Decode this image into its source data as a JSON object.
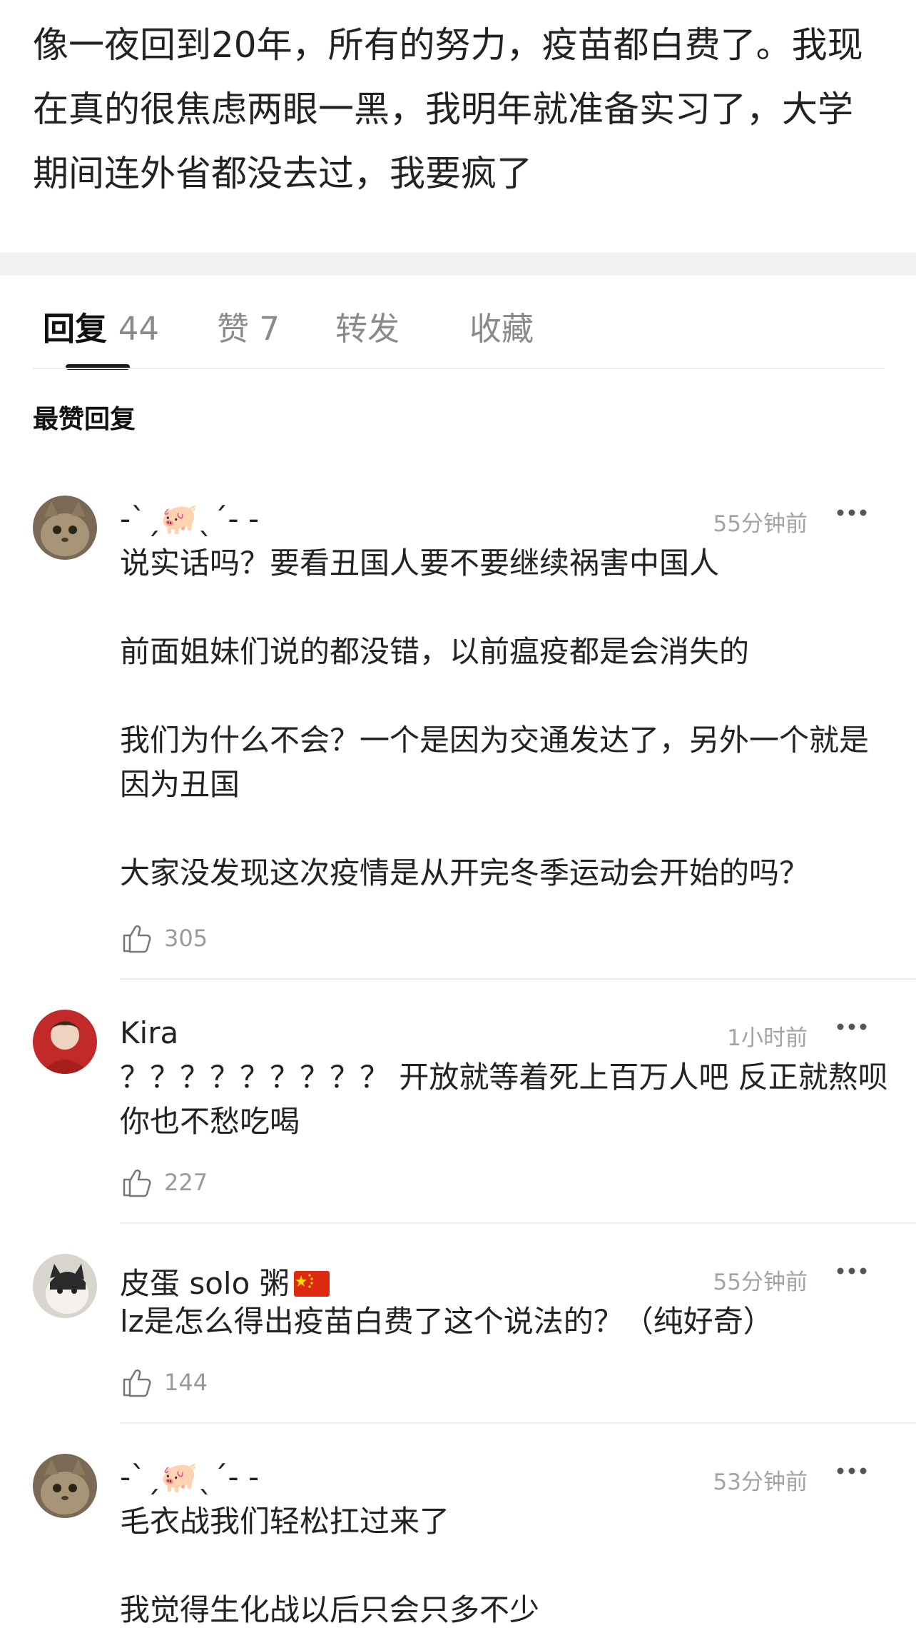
{
  "post": {
    "body": "像一夜回到20年，所有的努力，疫苗都白费了。我现在真的很焦虑两眼一黑，我明年就准备实习了，大学期间连外省都没去过，我要疯了"
  },
  "tabs": [
    {
      "label": "回复",
      "count": "44"
    },
    {
      "label": "赞",
      "count": "7"
    },
    {
      "label": "转发",
      "count": ""
    },
    {
      "label": "收藏",
      "count": ""
    }
  ],
  "section_title": "最赞回复",
  "comments": [
    {
      "username": "-ˋˏ🐖ˎˊ- -",
      "time": "55分钟前",
      "paragraphs": [
        "说实话吗？要看丑国人要不要继续祸害中国人",
        "",
        "前面姐妹们说的都没错，以前瘟疫都是会消失的",
        "",
        "我们为什么不会？一个是因为交通发达了，另外一个就是因为丑国",
        "",
        "大家没发现这次疫情是从开完冬季运动会开始的吗？"
      ],
      "likes": "305"
    },
    {
      "username": "Kira",
      "time": "1小时前",
      "paragraphs": [
        "？？？？？？？？？ 开放就等着死上百万人吧  反正就熬呗 你也不愁吃喝"
      ],
      "likes": "227"
    },
    {
      "username": "皮蛋 solo 粥",
      "time": "55分钟前",
      "paragraphs": [
        "lz是怎么得出疫苗白费了这个说法的？（纯好奇）"
      ],
      "likes": "144"
    },
    {
      "username": "-ˋˏ🐖ˎˊ- -",
      "time": "53分钟前",
      "paragraphs": [
        "毛衣战我们轻松扛过来了",
        "",
        "我觉得生化战以后只会只多不少"
      ],
      "likes": ""
    }
  ],
  "colors": {
    "divider": "#ececec",
    "muted": "#a3a3a3",
    "text": "#222222"
  }
}
